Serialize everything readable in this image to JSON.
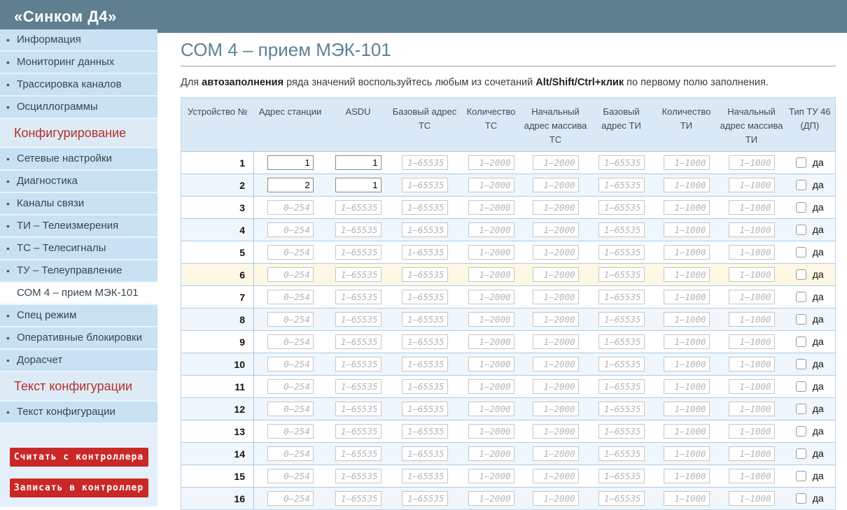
{
  "header": {
    "title": "«Синком Д4»"
  },
  "colors": {
    "header_bg": "#5f7e8f",
    "sidebar_item_bg": "#c8e1f3",
    "sidebar_section_text": "#b5302a",
    "button_bg": "#ca2727",
    "title_color": "#5e8296",
    "table_header_bg": "#dae9f6",
    "row_alt_bg": "#eff6fc",
    "row_highlight_bg": "#fcf8e3",
    "table_border": "#accce4"
  },
  "sidebar": {
    "items": [
      {
        "label": "Информация",
        "type": "link"
      },
      {
        "label": "Мониторинг данных",
        "type": "link"
      },
      {
        "label": "Трассировка каналов",
        "type": "link"
      },
      {
        "label": "Осциллограммы",
        "type": "link"
      },
      {
        "label": "Конфигурирование",
        "type": "section"
      },
      {
        "label": "Сетевые настройки",
        "type": "link"
      },
      {
        "label": "Диагностика",
        "type": "link"
      },
      {
        "label": "Каналы связи",
        "type": "link"
      },
      {
        "label": "ТИ – Телеизмерения",
        "type": "link"
      },
      {
        "label": "ТС – Телесигналы",
        "type": "link"
      },
      {
        "label": "ТУ – Телеуправление",
        "type": "link"
      },
      {
        "label": "СОМ 4 – прием МЭК-101",
        "type": "active"
      },
      {
        "label": "Спец режим",
        "type": "link"
      },
      {
        "label": "Оперативные блокировки",
        "type": "link"
      },
      {
        "label": "Дорасчет",
        "type": "link"
      },
      {
        "label": "Текст конфигурации",
        "type": "section"
      },
      {
        "label": "Текст конфигурации",
        "type": "link"
      }
    ],
    "buttons": [
      {
        "label": "Считать с контроллера"
      },
      {
        "label": "Записать в контроллер"
      }
    ]
  },
  "main": {
    "title": "СОМ 4 – прием МЭК-101",
    "instruction": {
      "prefix": "Для ",
      "bold1": "автозаполнения",
      "mid": " ряда значений воспользуйтесь любым из сочетаний ",
      "bold2": "Alt/Shift/Ctrl+клик",
      "suffix": " по первому полю заполнения."
    },
    "table": {
      "headers": [
        "Устройство №",
        "Адрес станции",
        "ASDU",
        "Базовый адрес ТС",
        "Количество ТС",
        "Начальный адрес массива ТС",
        "Базовый адрес ТИ",
        "Количество ТИ",
        "Начальный адрес массива ТИ",
        "Тип ТУ 46 (ДП)"
      ],
      "placeholders": {
        "station": "0–254",
        "asdu": "1–65535",
        "base_ts": "1–65535",
        "count_ts": "1–2000",
        "start_ts": "1–2000",
        "base_ti": "1–65535",
        "count_ti": "1–1000",
        "start_ti": "1–1000"
      },
      "checkbox_label": "да",
      "rows": [
        {
          "num": "1",
          "values": {
            "station": "1",
            "asdu": "1"
          },
          "checked": false
        },
        {
          "num": "2",
          "values": {
            "station": "2",
            "asdu": "1"
          },
          "checked": false
        },
        {
          "num": "3",
          "values": {},
          "checked": false
        },
        {
          "num": "4",
          "values": {},
          "checked": false
        },
        {
          "num": "5",
          "values": {},
          "checked": false
        },
        {
          "num": "6",
          "values": {},
          "checked": false,
          "highlight": true
        },
        {
          "num": "7",
          "values": {},
          "checked": false
        },
        {
          "num": "8",
          "values": {},
          "checked": false
        },
        {
          "num": "9",
          "values": {},
          "checked": false
        },
        {
          "num": "10",
          "values": {},
          "checked": false
        },
        {
          "num": "11",
          "values": {},
          "checked": false
        },
        {
          "num": "12",
          "values": {},
          "checked": false
        },
        {
          "num": "13",
          "values": {},
          "checked": false
        },
        {
          "num": "14",
          "values": {},
          "checked": false
        },
        {
          "num": "15",
          "values": {},
          "checked": false
        },
        {
          "num": "16",
          "values": {},
          "checked": false
        }
      ]
    }
  }
}
